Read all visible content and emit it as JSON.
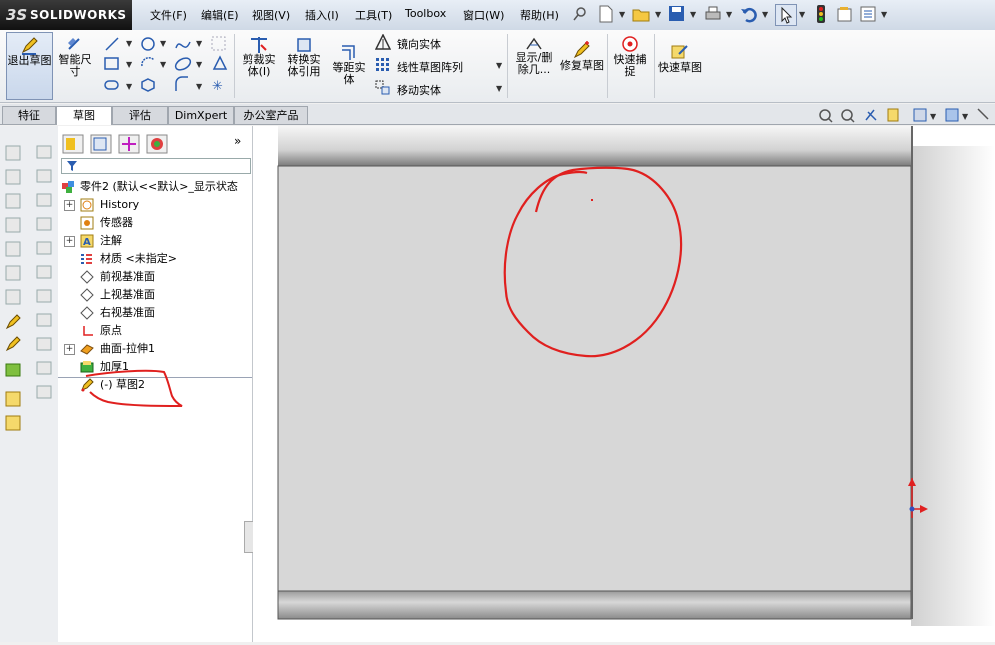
{
  "app": {
    "brand": "SOLIDWORKS",
    "brand_prefix": "3S"
  },
  "menu": [
    "文件(F)",
    "编辑(E)",
    "视图(V)",
    "插入(I)",
    "工具(T)",
    "Toolbox",
    "窗口(W)",
    "帮助(H)"
  ],
  "commands": {
    "exit_sketch": "退出草图",
    "smart_dim": "智能尺寸",
    "trim": "剪裁实体(I)",
    "convert": "转换实体引用",
    "offset": "等距实体",
    "mirror": "镜向实体",
    "linear_pattern": "线性草图阵列",
    "move": "移动实体",
    "show_delete": "显示/删除几...",
    "repair": "修复草图",
    "quick_snap": "快速捕捉",
    "quick_sketch": "快速草图"
  },
  "tabs": [
    "特征",
    "草图",
    "评估",
    "DimXpert",
    "办公室产品"
  ],
  "active_tab": "草图",
  "tree": {
    "root": "零件2 (默认<<默认>_显示状态",
    "items": [
      {
        "label": "History",
        "icon": "history-icon",
        "expand": true
      },
      {
        "label": "传感器",
        "icon": "sensor-icon",
        "expand": false
      },
      {
        "label": "注解",
        "icon": "annotation-icon",
        "expand": true
      },
      {
        "label": "材质 <未指定>",
        "icon": "material-icon",
        "expand": false
      },
      {
        "label": "前视基准面",
        "icon": "plane-icon",
        "expand": false
      },
      {
        "label": "上视基准面",
        "icon": "plane-icon",
        "expand": false
      },
      {
        "label": "右视基准面",
        "icon": "plane-icon",
        "expand": false
      },
      {
        "label": "原点",
        "icon": "origin-icon",
        "expand": false
      },
      {
        "label": "曲面-拉伸1",
        "icon": "surface-extrude-icon",
        "expand": true
      },
      {
        "label": "加厚1",
        "icon": "thicken-icon",
        "expand": false
      },
      {
        "label": "(-) 草图2",
        "icon": "sketch-icon",
        "expand": false
      }
    ]
  },
  "colors": {
    "annotation": "#e0201f",
    "accent": "#2a5db0",
    "panel": "#d7d7d7"
  }
}
